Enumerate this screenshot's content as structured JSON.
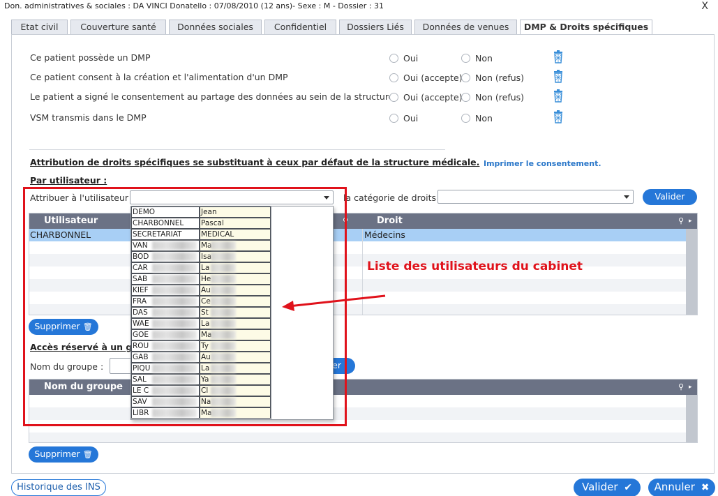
{
  "window": {
    "title": "Don. administratives & sociales : DA VINCI Donatello : 07/08/2010 (12 ans)- Sexe : M - Dossier : 31",
    "close": "X"
  },
  "tabs": [
    {
      "label": "Etat civil"
    },
    {
      "label": "Couverture santé"
    },
    {
      "label": "Données sociales"
    },
    {
      "label": "Confidentiel"
    },
    {
      "label": "Dossiers Liés"
    },
    {
      "label": "Données de venues"
    },
    {
      "label": "DMP & Droits spécifiques"
    }
  ],
  "questions": [
    {
      "label": "Ce patient possède un DMP",
      "opt1": "Oui",
      "opt2": "Non"
    },
    {
      "label": "Ce patient consent à la création et l'alimentation d'un DMP",
      "opt1": "Oui (accepte)",
      "opt2": "Non (refus)"
    },
    {
      "label": "Le patient a signé le consentement au partage des données au sein de la structure",
      "opt1": "Oui (accepte)",
      "opt2": "Non (refus)"
    },
    {
      "label": "VSM transmis dans le DMP",
      "opt1": "Oui",
      "opt2": "Non"
    }
  ],
  "rights": {
    "section_title": "Attribution de droits spécifiques se substituant à ceux par défaut de la structure médicale.",
    "print_link": "Imprimer le consentement.",
    "by_user_title": "Par utilisateur :",
    "assign_label": "Attribuer à l'utilisateur :",
    "category_label": "la catégorie de droits :",
    "validate_button": "Valider",
    "grid_headers": {
      "user": "Utilisateur",
      "right": "Droit"
    },
    "rows": [
      {
        "user": "CHARBONNEL",
        "right": "Médecins"
      }
    ],
    "delete_button": "Supprimer"
  },
  "group": {
    "section_title": "Accès réservé à un gro",
    "name_label": "Nom du groupe :",
    "button_tail": "er",
    "grid_header": "Nom du groupe",
    "delete_button": "Supprimer"
  },
  "dropdown_users": [
    {
      "c1": "DEMO",
      "c2": "Jean"
    },
    {
      "c1": "CHARBONNEL",
      "c2": "Pascal"
    },
    {
      "c1": "SECRETARIAT",
      "c2": "MEDICAL"
    },
    {
      "c1": "VAN",
      "c2": "Ma"
    },
    {
      "c1": "BOD",
      "c2": "Isa"
    },
    {
      "c1": "CAR",
      "c2": "La"
    },
    {
      "c1": "SAB",
      "c2": "He"
    },
    {
      "c1": "KIEF",
      "c2": "Au"
    },
    {
      "c1": "FRA",
      "c2": "Ce"
    },
    {
      "c1": "DAS",
      "c2": "St"
    },
    {
      "c1": "WAE",
      "c2": "La"
    },
    {
      "c1": "GOE",
      "c2": "Ma"
    },
    {
      "c1": "ROU",
      "c2": "Ty"
    },
    {
      "c1": "GAB",
      "c2": "Au"
    },
    {
      "c1": "PIQU",
      "c2": "La"
    },
    {
      "c1": "SAL",
      "c2": "Ya"
    },
    {
      "c1": "LE C",
      "c2": "Cl"
    },
    {
      "c1": "SAV",
      "c2": "Na"
    },
    {
      "c1": "LIBR",
      "c2": "Ma"
    }
  ],
  "annotation": "Liste des utilisateurs du cabinet",
  "footer": {
    "history_button": "Historique des INS",
    "validate_button": "Valider",
    "cancel_button": "Annuler"
  },
  "colors": {
    "accent": "#2577d8",
    "grid_header": "#6b7285",
    "selected_row": "#a8cff5",
    "annotation": "#e0121b"
  }
}
